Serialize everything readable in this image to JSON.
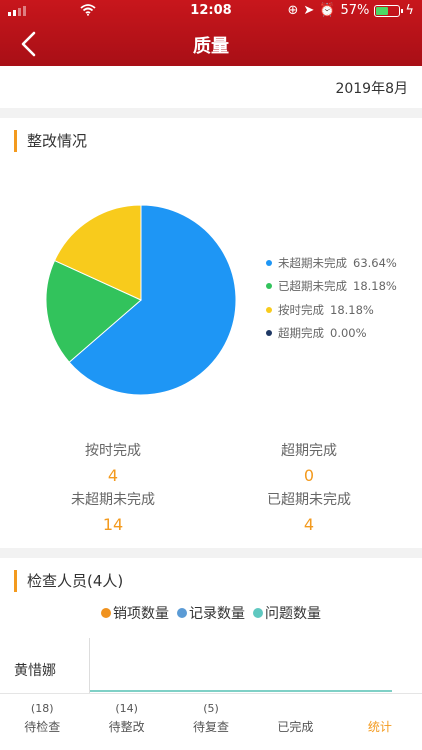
{
  "status_bar": {
    "time": "12:08",
    "battery": "57%",
    "battery_level": 0.57
  },
  "nav": {
    "title": "质量",
    "back_icon": "chevron-left-icon"
  },
  "date": "2019年8月",
  "rectification": {
    "title": "整改情况",
    "legend": [
      {
        "label": "未超期未完成",
        "pct": "63.64%",
        "color": "#1e96f5"
      },
      {
        "label": "已超期未完成",
        "pct": "18.18%",
        "color": "#32c35c"
      },
      {
        "label": "按时完成",
        "pct": "18.18%",
        "color": "#f8cb1c"
      },
      {
        "label": "超期完成",
        "pct": "0.00%",
        "color": "#1f3864"
      }
    ],
    "stats": {
      "on_time": {
        "label": "按时完成",
        "value": "4"
      },
      "overdue_done": {
        "label": "超期完成",
        "value": "0"
      },
      "not_overdue_pending": {
        "label": "未超期未完成",
        "value": "14"
      },
      "overdue_pending": {
        "label": "已超期未完成",
        "value": "4"
      }
    }
  },
  "chart_data": {
    "type": "pie",
    "labels": [
      "未超期未完成",
      "已超期未完成",
      "按时完成",
      "超期完成"
    ],
    "values": [
      63.64,
      18.18,
      18.18,
      0.0
    ],
    "colors": [
      "#1e96f5",
      "#32c35c",
      "#f8cb1c",
      "#1f3864"
    ]
  },
  "inspectors": {
    "title": "检查人员(4人)",
    "legend": [
      {
        "label": "销项数量",
        "color": "#f0921e"
      },
      {
        "label": "记录数量",
        "color": "#5b9bd5"
      },
      {
        "label": "问题数量",
        "color": "#5fc8c0"
      }
    ],
    "rows": [
      {
        "name": "黄惜娜"
      }
    ]
  },
  "tabbar": [
    {
      "count": "(18)",
      "label": "待检查"
    },
    {
      "count": "(14)",
      "label": "待整改"
    },
    {
      "count": "(5)",
      "label": "待复查"
    },
    {
      "count": "",
      "label": "已完成"
    },
    {
      "count": "",
      "label": "统计",
      "active": true
    }
  ]
}
